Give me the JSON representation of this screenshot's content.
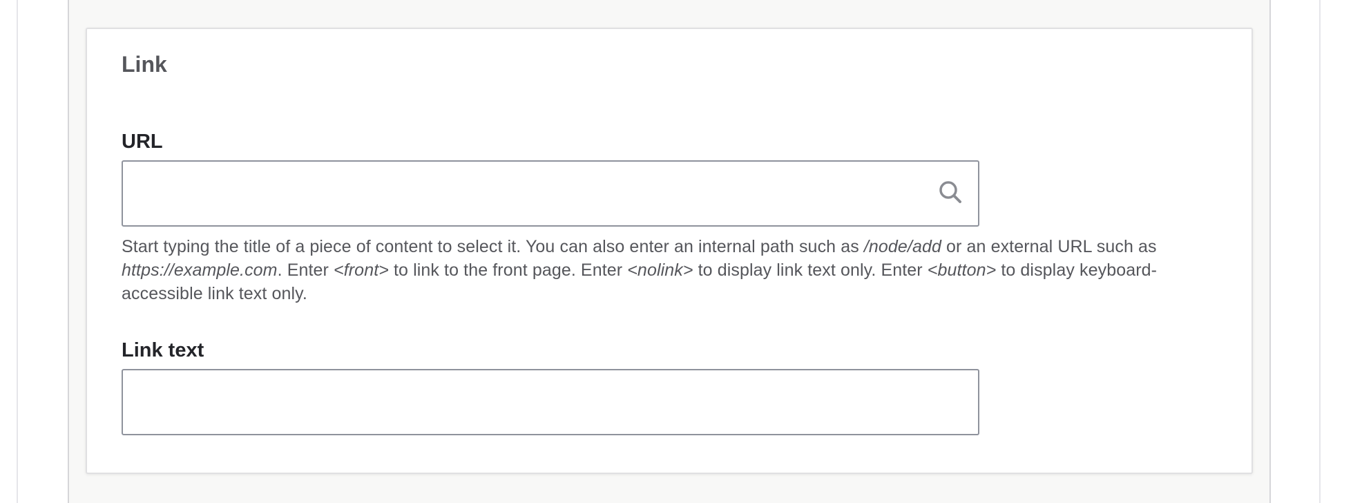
{
  "section": {
    "title": "Link"
  },
  "url_field": {
    "label": "URL",
    "value": "",
    "placeholder": "",
    "icon": "search-icon",
    "description": {
      "part1": "Start typing the title of a piece of content to select it. You can also enter an internal path such as ",
      "path_example": "/node/add",
      "part2": " or an external URL such as ",
      "url_example": "https://example.com",
      "part3": ". Enter ",
      "front_token": "<front>",
      "part4": " to link to the front page. Enter ",
      "nolink_token": "<nolink>",
      "part5": " to display link text only. Enter ",
      "button_token": "<button>",
      "part6": " to display key­board-accessible link text only."
    }
  },
  "link_text_field": {
    "label": "Link text",
    "value": "",
    "placeholder": ""
  },
  "colors": {
    "background": "#f8f8f7",
    "card": "#ffffff",
    "input_border": "#8e929c",
    "label": "#232429",
    "muted_text": "#55565b"
  }
}
